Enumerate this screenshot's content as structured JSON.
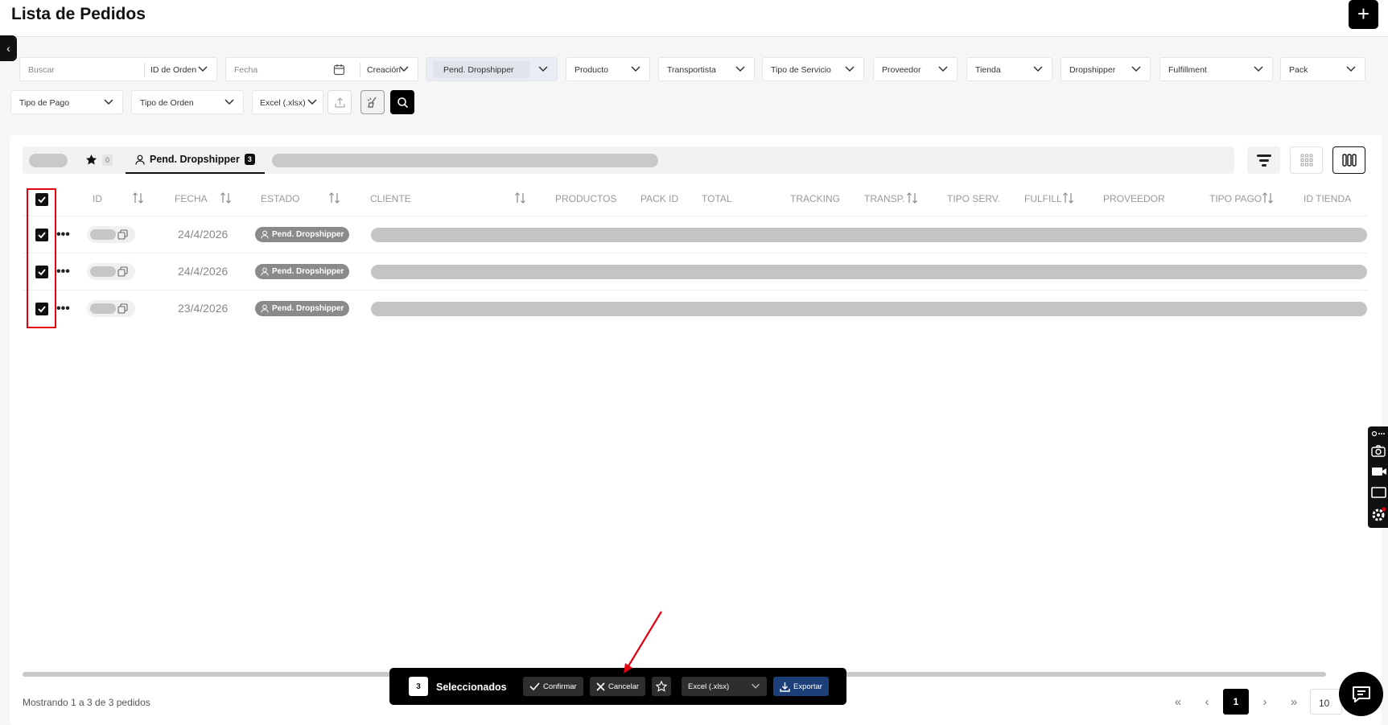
{
  "header": {
    "title": "Lista de Pedidos",
    "add_icon": "+",
    "collapse_icon": "‹"
  },
  "filters": {
    "search_placeholder": "Buscar",
    "order_id": "ID de Orden",
    "date_placeholder": "Fecha",
    "creation": "Creación",
    "status": "Pend. Dropshipper",
    "product": "Producto",
    "carrier": "Transportista",
    "service_type": "Tipo de Servicio",
    "supplier": "Proveedor",
    "store": "Tienda",
    "dropshipper": "Dropshipper",
    "fulfillment": "Fulfillment",
    "pack": "Pack",
    "payment_type": "Tipo de Pago",
    "order_type": "Tipo de Orden",
    "export_format": "Excel (.xlsx)"
  },
  "tabs": {
    "favorites_count": "0",
    "active_label": "Pend. Dropshipper",
    "active_count": "3"
  },
  "table": {
    "columns": [
      "ID",
      "FECHA",
      "ESTADO",
      "CLIENTE",
      "PRODUCTOS",
      "PACK ID",
      "TOTAL",
      "TRACKING",
      "TRANSP.",
      "TIPO SERV.",
      "FULFILL",
      "PROVEEDOR",
      "TIPO PAGO",
      "ID TIENDA"
    ],
    "rows": [
      {
        "date": "24/4/2026",
        "status": "Pend. Dropshipper"
      },
      {
        "date": "24/4/2026",
        "status": "Pend. Dropshipper"
      },
      {
        "date": "23/4/2026",
        "status": "Pend. Dropshipper"
      }
    ]
  },
  "footer": {
    "showing": "Mostrando 1 a 3 de 3 pedidos",
    "current_page": "1",
    "per_page": "10",
    "first": "«",
    "prev": "‹",
    "next": "›",
    "last": "»"
  },
  "bulk": {
    "count": "3",
    "label": "Seleccionados",
    "confirm": "Confirmar",
    "cancel": "Cancelar",
    "export_format": "Excel (.xlsx)",
    "export": "Exportar"
  }
}
